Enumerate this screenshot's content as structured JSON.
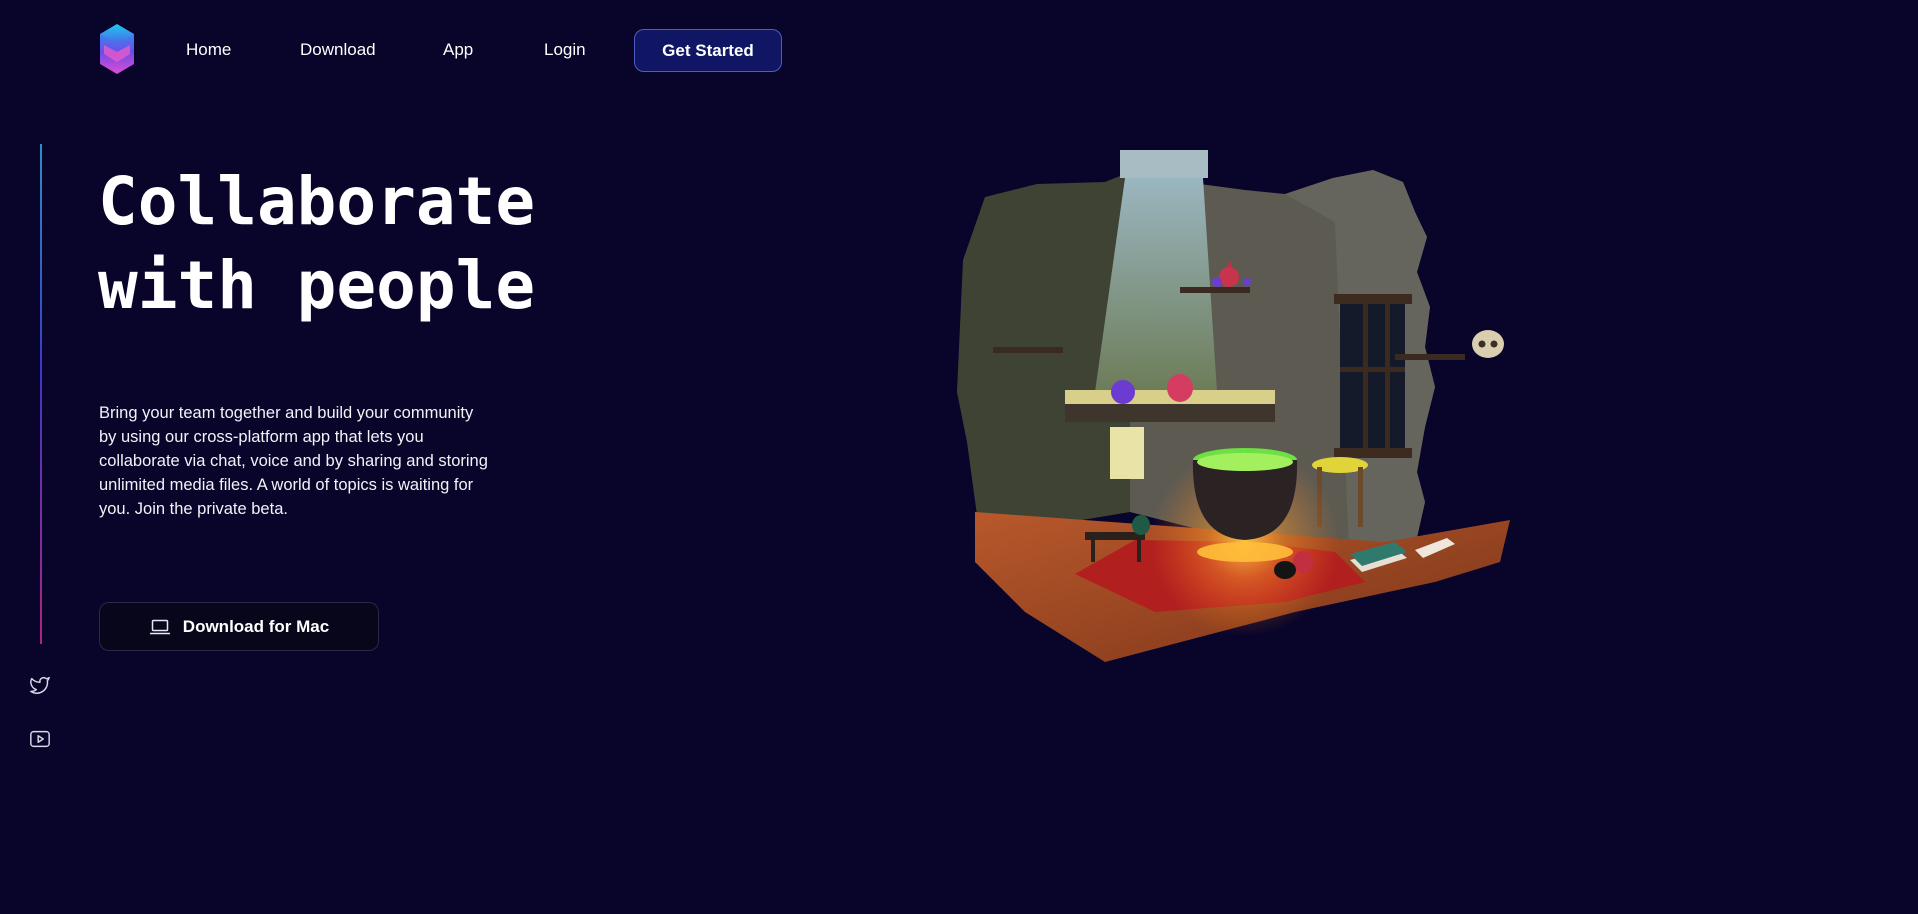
{
  "nav": {
    "home": "Home",
    "download": "Download",
    "app": "App",
    "login": "Login",
    "cta": "Get Started"
  },
  "hero": {
    "title_line1": "Collaborate",
    "title_line2": "with people",
    "description": "Bring your team together and build your community by using our cross-platform app that lets you collaborate via chat, voice and by sharing and storing unlimited media files. A world of topics is waiting for you. Join the private beta.",
    "download_button": "Download for Mac"
  },
  "icons": {
    "logo": "hexagon-logo-icon",
    "download_button_icon": "laptop-icon",
    "social": [
      "twitter-icon",
      "youtube-icon"
    ]
  },
  "colors": {
    "background": "#08042a",
    "cta_background": "#101663",
    "cta_border": "#4d5cc0"
  }
}
